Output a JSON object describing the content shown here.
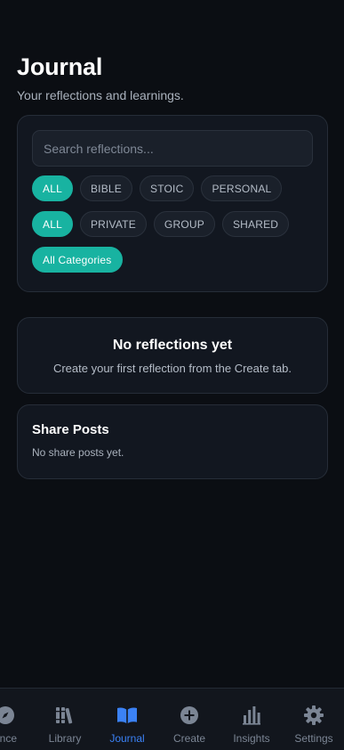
{
  "header": {
    "title": "Journal",
    "subtitle": "Your reflections and learnings."
  },
  "search": {
    "placeholder": "Search reflections...",
    "value": ""
  },
  "filters": {
    "source": [
      "ALL",
      "BIBLE",
      "STOIC",
      "PERSONAL"
    ],
    "source_selected": "ALL",
    "visibility": [
      "ALL",
      "PRIVATE",
      "GROUP",
      "SHARED"
    ],
    "visibility_selected": "ALL",
    "category": "All Categories"
  },
  "empty_state": {
    "title": "No reflections yet",
    "message": "Create your first reflection from the Create tab."
  },
  "share_posts": {
    "title": "Share Posts",
    "message": "No share posts yet."
  },
  "tabs": [
    {
      "label": "ance",
      "icon": "compass-icon"
    },
    {
      "label": "Library",
      "icon": "library-icon"
    },
    {
      "label": "Journal",
      "icon": "book-open-icon",
      "active": true
    },
    {
      "label": "Create",
      "icon": "plus-circle-icon"
    },
    {
      "label": "Insights",
      "icon": "bar-chart-icon"
    },
    {
      "label": "Settings",
      "icon": "gear-icon"
    }
  ],
  "colors": {
    "accent": "#18b3a1",
    "active_tab": "#3b82f6",
    "background": "#0b0e13",
    "card": "#121720"
  }
}
